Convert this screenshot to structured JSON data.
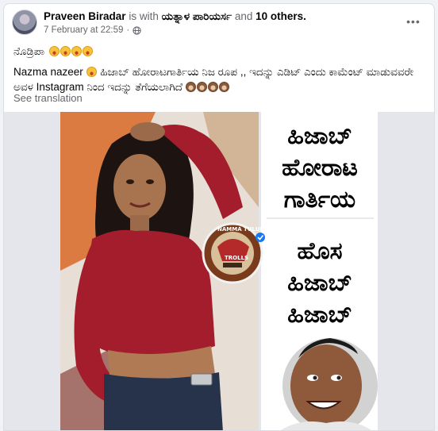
{
  "post": {
    "author": "Praveen Biradar",
    "with_text": "is with",
    "tagged": "ಯತ್ನಾಳ ಪಾರಿಯರ್ಸ",
    "and_text": "and",
    "others": "10 others.",
    "timestamp": "7 February at 22:59",
    "separator": "·",
    "audience_icon": "globe-icon",
    "more_icon": "more-options-icon",
    "more_glyph": "•••",
    "caption_line1": "ನೊಡ್ರಿಪಾ",
    "mentioned": "Nazma nazeer",
    "caption_line2": "ಹಿಜಾಬ್ ಹೋರಾಟಗಾರ್ತಿಯ ನಿಜ ರೂಪ ,, ಇದನ್ನು ಎಡಿಟ್ ಎಂದು ಕಾಮೆಂಟ್ ಮಾಡುವವರೇ ಅವಳ Instagram ನಿಂದ ಇದನ್ನು ತೆಗೆಯಲಾಗಿದೆ",
    "see_translation": "See translation"
  },
  "image": {
    "headline_lines": [
      "ಹಿಜಾಬ್",
      "ಹೋರಾಟ",
      "ಗಾರ್ತಿಯ"
    ],
    "subline_lines": [
      "ಹೊಸ",
      "ಹಿಜಾಬ್",
      "ಹಿಜಾಬ್"
    ],
    "watermark_top": "NAMMA TULUNADU",
    "watermark_bottom": "TROLLS"
  },
  "colors": {
    "link": "#050505",
    "muted": "#65676b",
    "verified": "#1877f2",
    "top_red": "#a31d2c"
  }
}
